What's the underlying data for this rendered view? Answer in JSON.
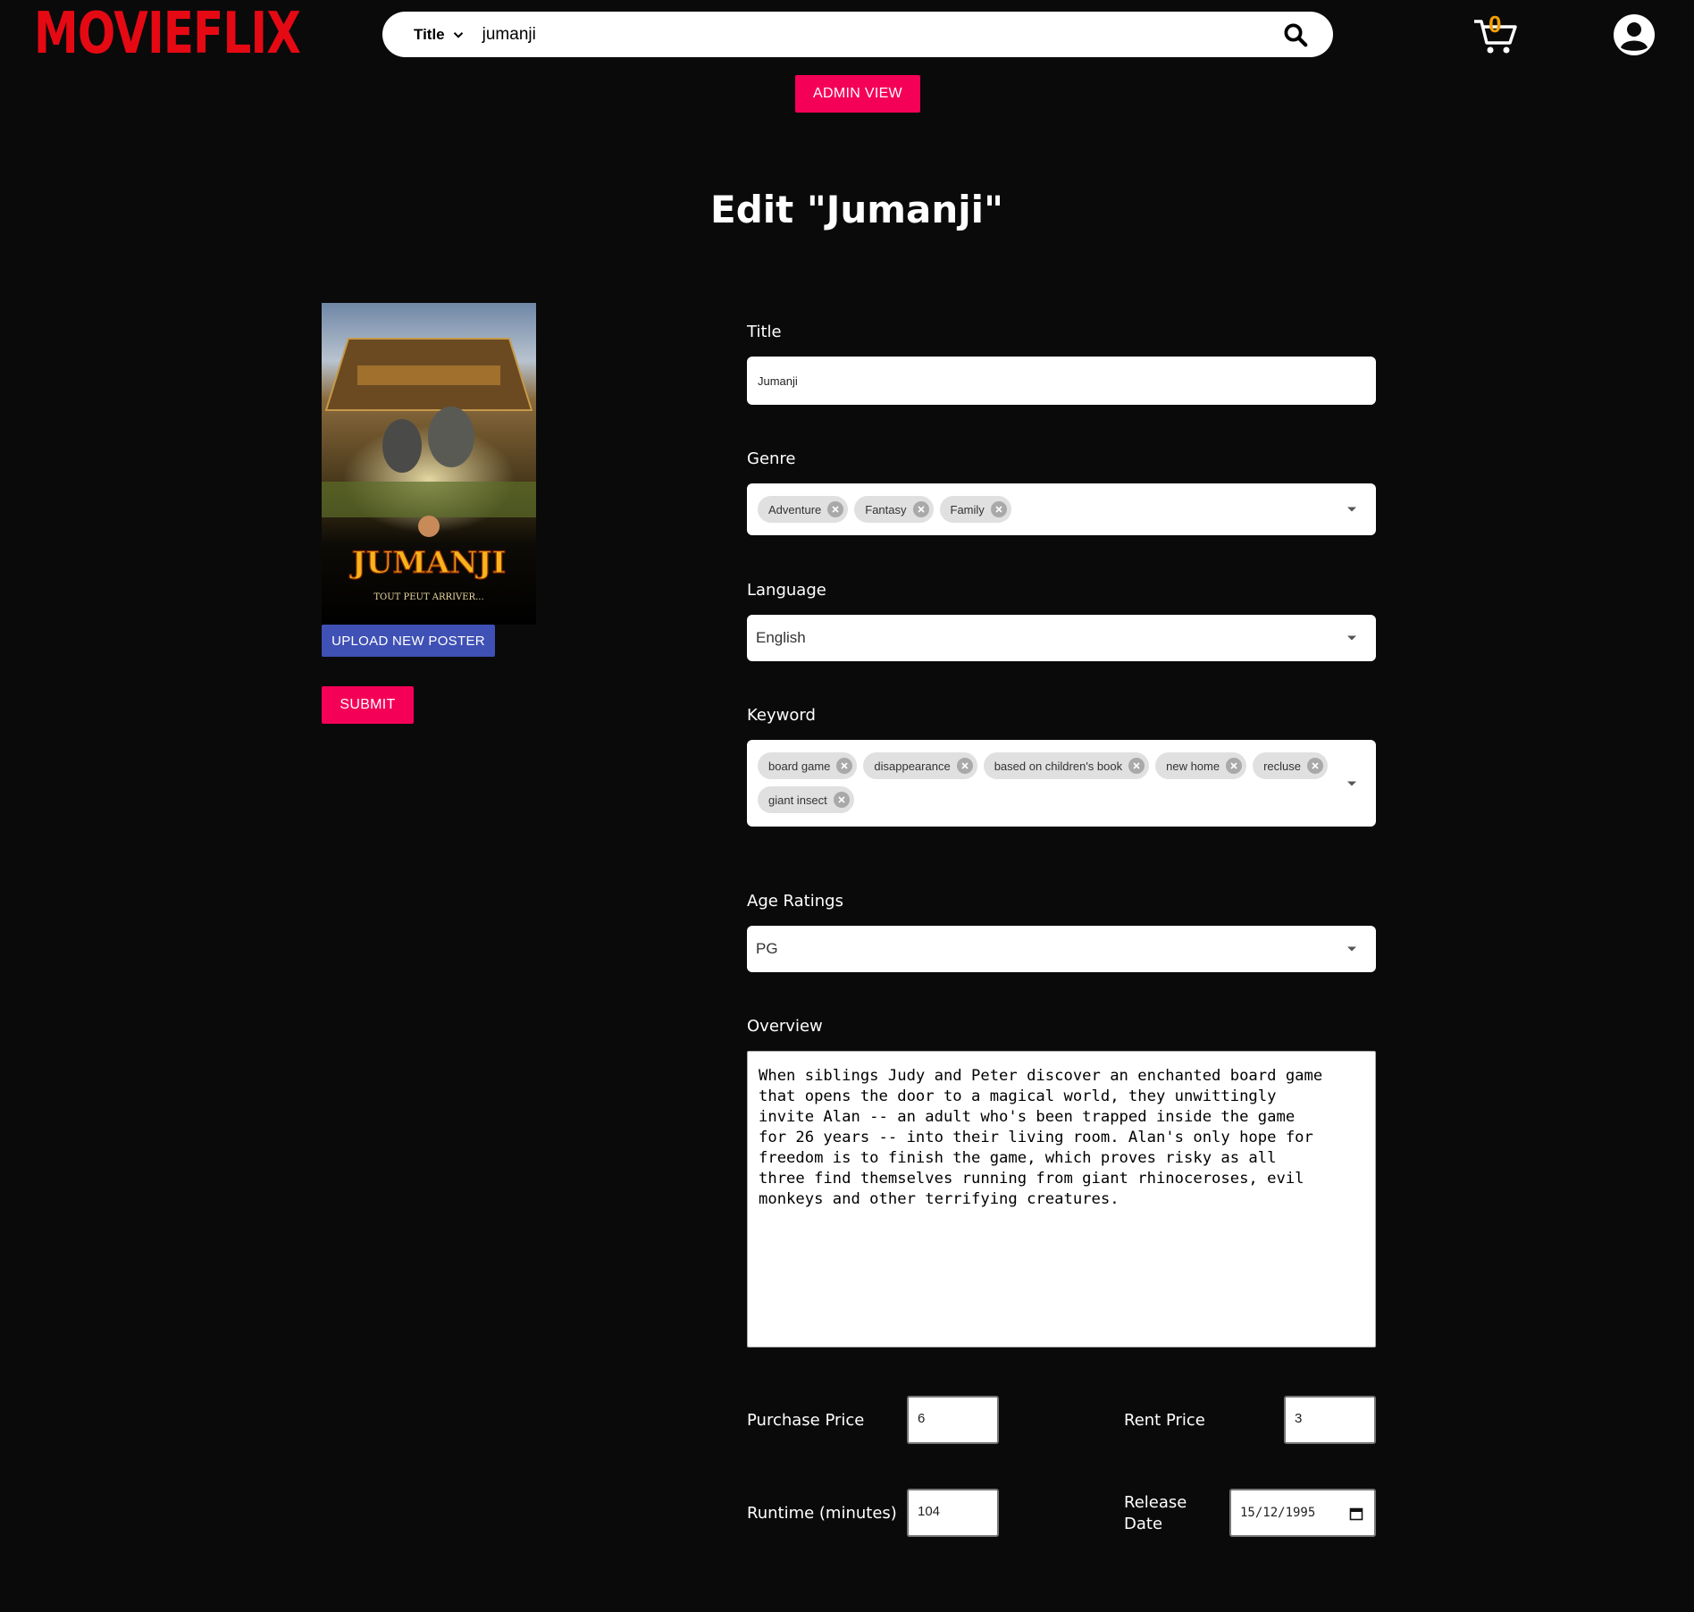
{
  "app": {
    "logo": "MOVIEFLIX"
  },
  "search": {
    "field": "Title",
    "query": "jumanji"
  },
  "cart": {
    "count": "0"
  },
  "admin_button": "ADMIN VIEW",
  "page_title": "Edit \"Jumanji\"",
  "poster": {
    "title": "JUMANJI",
    "tagline": "TOUT PEUT ARRIVER...",
    "upload_label": "UPLOAD NEW POSTER",
    "submit_label": "SUBMIT"
  },
  "form": {
    "title": {
      "label": "Title",
      "value": "Jumanji"
    },
    "genre": {
      "label": "Genre",
      "chips": [
        "Adventure",
        "Fantasy",
        "Family"
      ]
    },
    "language": {
      "label": "Language",
      "value": "English"
    },
    "keyword": {
      "label": "Keyword",
      "chips": [
        "board game",
        "disappearance",
        "based on children's book",
        "new home",
        "recluse",
        "giant insect"
      ]
    },
    "age_rating": {
      "label": "Age Ratings",
      "value": "PG"
    },
    "overview": {
      "label": "Overview",
      "value": "When siblings Judy and Peter discover an enchanted board game\nthat opens the door to a magical world, they unwittingly\ninvite Alan -- an adult who's been trapped inside the game\nfor 26 years -- into their living room. Alan's only hope for\nfreedom is to finish the game, which proves risky as all\nthree find themselves running from giant rhinoceroses, evil\nmonkeys and other terrifying creatures."
    },
    "purchase_price": {
      "label": "Purchase Price",
      "value": "6"
    },
    "rent_price": {
      "label": "Rent Price",
      "value": "3"
    },
    "runtime": {
      "label": "Runtime (minutes)",
      "value": "104"
    },
    "release_date": {
      "label_line1": "Release",
      "label_line2": "Date",
      "value": "15/12/1995"
    }
  },
  "colors": {
    "brand": "#e50914",
    "accent": "#f50057",
    "upload": "#3f51b5",
    "cart_count": "#f5a000"
  }
}
